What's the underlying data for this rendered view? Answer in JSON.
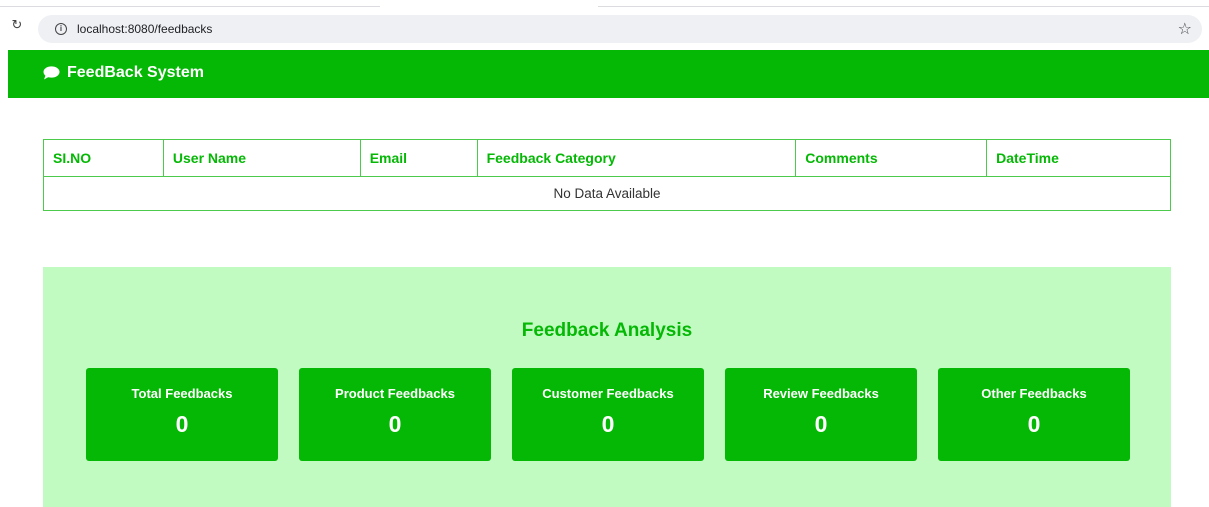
{
  "browser": {
    "url": "localhost:8080/feedbacks",
    "reload_icon": "reload-icon",
    "info_icon": "info-icon",
    "bookmark_icon": "star-icon"
  },
  "navbar": {
    "brand_icon": "chat-icon",
    "brand": "FeedBack System",
    "color": "#05b805"
  },
  "table": {
    "headers": [
      "SI.NO",
      "User Name",
      "Email",
      "Feedback Category",
      "Comments",
      "DateTime"
    ],
    "empty_message": "No Data Available"
  },
  "analysis": {
    "title": "Feedback Analysis",
    "background": "#c2fbc2",
    "cards": [
      {
        "label": "Total Feedbacks",
        "value": "0"
      },
      {
        "label": "Product Feedbacks",
        "value": "0"
      },
      {
        "label": "Customer Feedbacks",
        "value": "0"
      },
      {
        "label": "Review Feedbacks",
        "value": "0"
      },
      {
        "label": "Other Feedbacks",
        "value": "0"
      }
    ]
  }
}
